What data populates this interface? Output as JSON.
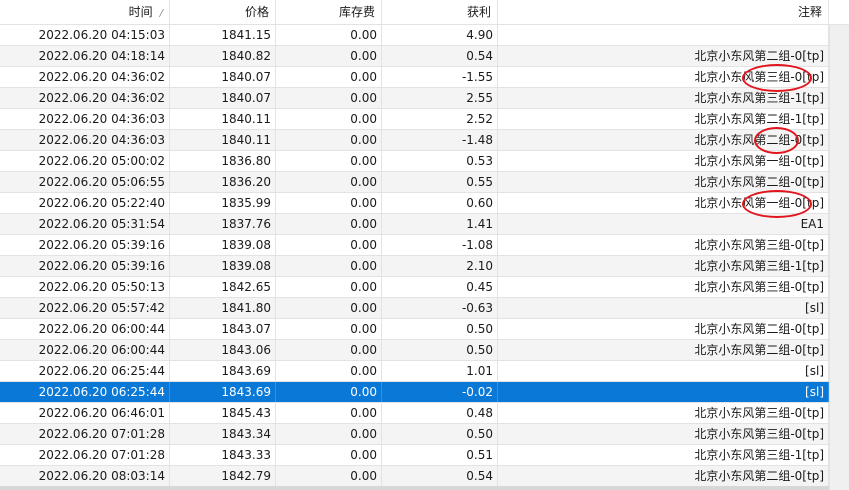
{
  "columns": {
    "time": "时间",
    "price": "价格",
    "swap": "库存费",
    "profit": "获利",
    "comment": "注释"
  },
  "rows": [
    {
      "time": "2022.06.20 04:15:03",
      "price": "1841.15",
      "swap": "0.00",
      "profit": "4.90",
      "comment": ""
    },
    {
      "time": "2022.06.20 04:18:14",
      "price": "1840.82",
      "swap": "0.00",
      "profit": "0.54",
      "comment": "北京小东风第二组-0[tp]"
    },
    {
      "time": "2022.06.20 04:36:02",
      "price": "1840.07",
      "swap": "0.00",
      "profit": "-1.55",
      "comment": "北京小东风第三组-0[tp]"
    },
    {
      "time": "2022.06.20 04:36:02",
      "price": "1840.07",
      "swap": "0.00",
      "profit": "2.55",
      "comment": "北京小东风第三组-1[tp]"
    },
    {
      "time": "2022.06.20 04:36:03",
      "price": "1840.11",
      "swap": "0.00",
      "profit": "2.52",
      "comment": "北京小东风第二组-1[tp]"
    },
    {
      "time": "2022.06.20 04:36:03",
      "price": "1840.11",
      "swap": "0.00",
      "profit": "-1.48",
      "comment": "北京小东风第二组-0[tp]"
    },
    {
      "time": "2022.06.20 05:00:02",
      "price": "1836.80",
      "swap": "0.00",
      "profit": "0.53",
      "comment": "北京小东风第一组-0[tp]"
    },
    {
      "time": "2022.06.20 05:06:55",
      "price": "1836.20",
      "swap": "0.00",
      "profit": "0.55",
      "comment": "北京小东风第二组-0[tp]"
    },
    {
      "time": "2022.06.20 05:22:40",
      "price": "1835.99",
      "swap": "0.00",
      "profit": "0.60",
      "comment": "北京小东风第一组-0[tp]"
    },
    {
      "time": "2022.06.20 05:31:54",
      "price": "1837.76",
      "swap": "0.00",
      "profit": "1.41",
      "comment": "EA1"
    },
    {
      "time": "2022.06.20 05:39:16",
      "price": "1839.08",
      "swap": "0.00",
      "profit": "-1.08",
      "comment": "北京小东风第三组-0[tp]"
    },
    {
      "time": "2022.06.20 05:39:16",
      "price": "1839.08",
      "swap": "0.00",
      "profit": "2.10",
      "comment": "北京小东风第三组-1[tp]"
    },
    {
      "time": "2022.06.20 05:50:13",
      "price": "1842.65",
      "swap": "0.00",
      "profit": "0.45",
      "comment": "北京小东风第三组-0[tp]"
    },
    {
      "time": "2022.06.20 05:57:42",
      "price": "1841.80",
      "swap": "0.00",
      "profit": "-0.63",
      "comment": "[sl]"
    },
    {
      "time": "2022.06.20 06:00:44",
      "price": "1843.07",
      "swap": "0.00",
      "profit": "0.50",
      "comment": "北京小东风第二组-0[tp]"
    },
    {
      "time": "2022.06.20 06:00:44",
      "price": "1843.06",
      "swap": "0.00",
      "profit": "0.50",
      "comment": "北京小东风第二组-0[tp]"
    },
    {
      "time": "2022.06.20 06:25:44",
      "price": "1843.69",
      "swap": "0.00",
      "profit": "1.01",
      "comment": "[sl]"
    },
    {
      "time": "2022.06.20 06:25:44",
      "price": "1843.69",
      "swap": "0.00",
      "profit": "-0.02",
      "comment": "[sl]",
      "selected": true
    },
    {
      "time": "2022.06.20 06:46:01",
      "price": "1845.43",
      "swap": "0.00",
      "profit": "0.48",
      "comment": "北京小东风第三组-0[tp]"
    },
    {
      "time": "2022.06.20 07:01:28",
      "price": "1843.34",
      "swap": "0.00",
      "profit": "0.50",
      "comment": "北京小东风第三组-0[tp]"
    },
    {
      "time": "2022.06.20 07:01:28",
      "price": "1843.33",
      "swap": "0.00",
      "profit": "0.51",
      "comment": "北京小东风第三组-1[tp]"
    },
    {
      "time": "2022.06.20 08:03:14",
      "price": "1842.79",
      "swap": "0.00",
      "profit": "0.54",
      "comment": "北京小东风第二组-0[tp]"
    }
  ],
  "theme": {
    "selected_row": "#0a78d7",
    "alt_row": "#f4f4f4",
    "annotation_circle": "#e2151d"
  }
}
